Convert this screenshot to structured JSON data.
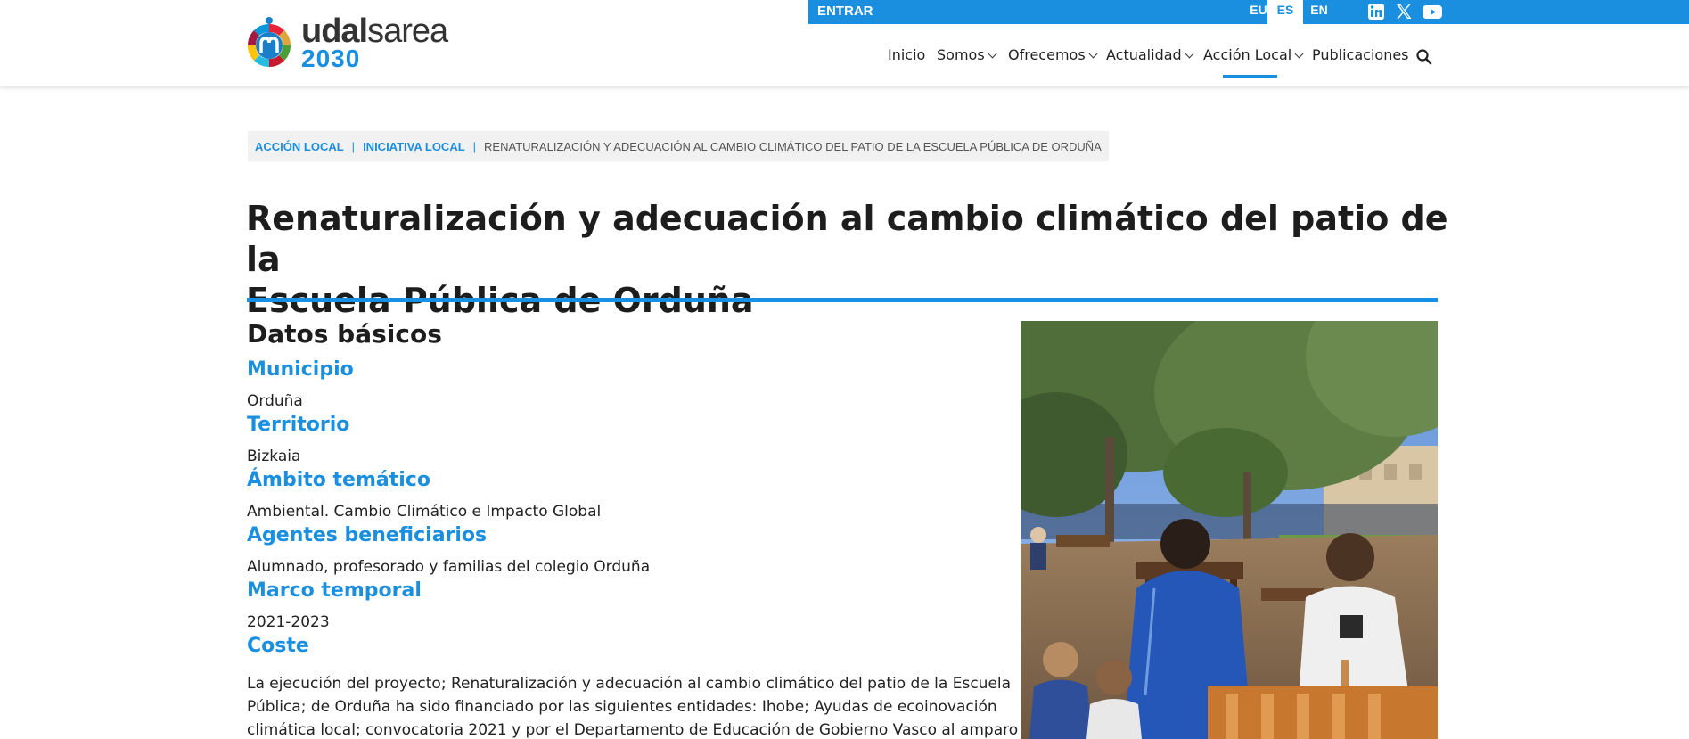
{
  "header": {
    "logo_name_bold": "udal",
    "logo_name_regular": "sarea",
    "logo_year": "2030",
    "login_label": "ENTRAR",
    "languages": [
      {
        "code": "EU",
        "active": false
      },
      {
        "code": "ES",
        "active": true
      },
      {
        "code": "EN",
        "active": false
      }
    ],
    "social": [
      "linkedin-icon",
      "x-icon",
      "youtube-icon"
    ],
    "nav": [
      {
        "label": "Inicio",
        "dropdown": false,
        "active": false
      },
      {
        "label": "Somos",
        "dropdown": true,
        "active": false
      },
      {
        "label": "Ofrecemos",
        "dropdown": true,
        "active": false
      },
      {
        "label": "Actualidad",
        "dropdown": true,
        "active": false
      },
      {
        "label": "Acción Local",
        "dropdown": true,
        "active": true
      },
      {
        "label": "Publicaciones",
        "dropdown": false,
        "active": false
      }
    ]
  },
  "breadcrumb": {
    "items": [
      "ACCIÓN LOCAL",
      "INICIATIVA LOCAL"
    ],
    "current": "RENATURALIZACIÓN Y ADECUACIÓN AL CAMBIO CLIMÁTICO DEL PATIO DE LA ESCUELA PÚBLICA DE ORDUÑA"
  },
  "page": {
    "title_line1": "Renaturalización y adecuación al cambio climático del patio de la",
    "title_line2": "Escuela Pública de Orduña",
    "section_title": "Datos básicos",
    "fields": [
      {
        "label": "Municipio",
        "value": "Orduña"
      },
      {
        "label": "Territorio",
        "value": "Bizkaia"
      },
      {
        "label": "Ámbito temático",
        "value": "Ambiental. Cambio Climático e Impacto Global"
      },
      {
        "label": "Agentes beneficiarios",
        "value": "Alumnado, profesorado y familias del colegio Orduña"
      },
      {
        "label": "Marco temporal",
        "value": "2021-2023"
      },
      {
        "label": "Coste",
        "value": ""
      }
    ],
    "cost_text": [
      "La ejecución del proyecto; Renaturalización y adecuación al cambio climático del patio de la Escuela",
      "Pública; de Orduña ha sido financiado por las siguientes entidades: Ihobe; Ayudas de ecoinovación",
      "climática local; convocatoria 2021 y por el Departamento de Educación de Gobierno Vasco al amparo de"
    ]
  },
  "colors": {
    "accent": "#1a8fe0",
    "text": "#222222",
    "breadcrumb_bg": "#f1f1f1"
  }
}
